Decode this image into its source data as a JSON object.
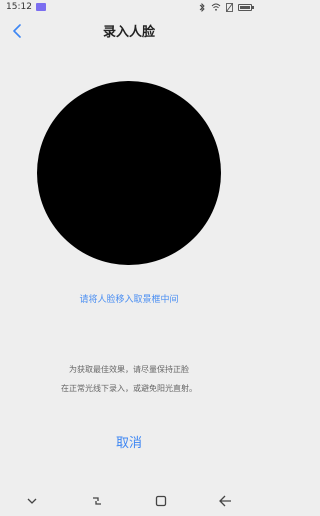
{
  "status_bar": {
    "time": "15:12"
  },
  "header": {
    "title": "录入人脸"
  },
  "main": {
    "primary_hint": "请将人脸移入取景框中间",
    "tips": [
      "为获取最佳效果，请尽量保持正脸",
      "在正常光线下录入，或避免阳光直射。"
    ],
    "cancel_label": "取消"
  },
  "colors": {
    "accent": "#3d86f3",
    "background": "#eeeeee",
    "circle": "#000000"
  },
  "icons": {
    "back": "chevron-left-icon",
    "nav_down": "chevron-down-icon",
    "nav_recent": "recent-apps-icon",
    "nav_home": "home-square-icon",
    "nav_back": "back-arrow-icon"
  }
}
